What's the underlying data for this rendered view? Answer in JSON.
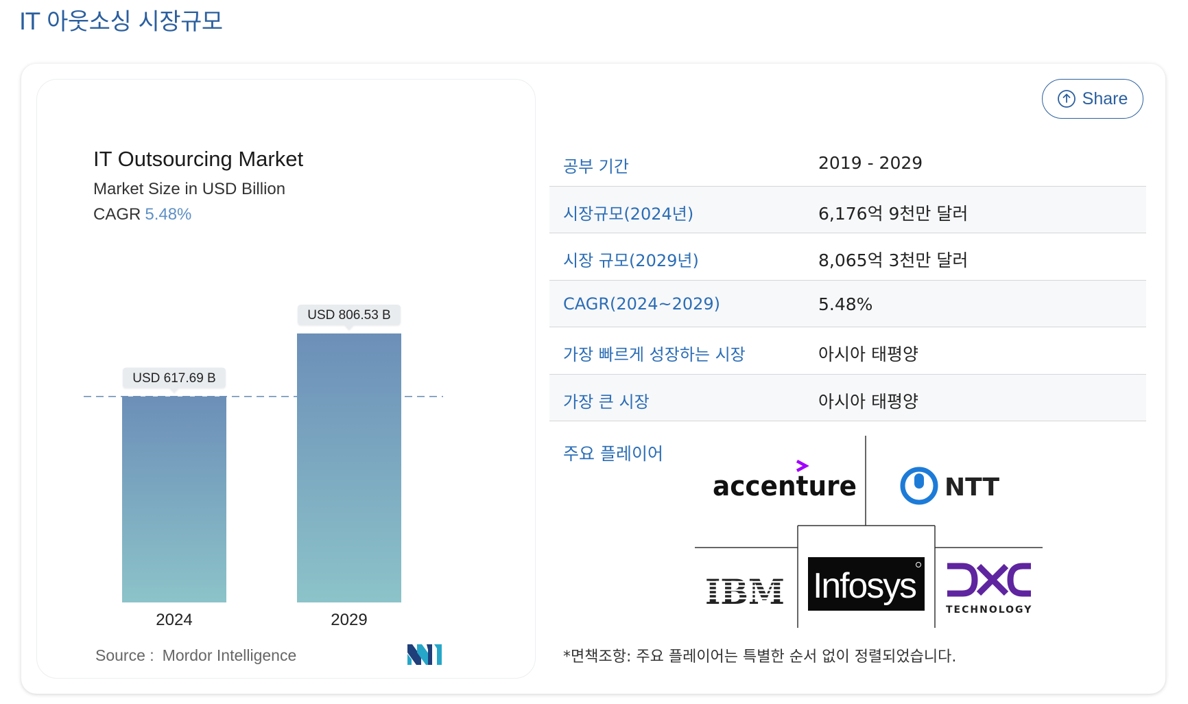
{
  "page": {
    "title": "IT 아웃소싱 시장규모"
  },
  "share": {
    "label": "Share"
  },
  "chart_card": {
    "source_label": "Source :",
    "source_value": "Mordor Intelligence"
  },
  "chart_data": {
    "type": "bar",
    "title": "IT Outsourcing Market",
    "subtitle": "Market Size in USD Billion",
    "cagr_label": "CAGR",
    "cagr_value": "5.48%",
    "categories": [
      "2024",
      "2029"
    ],
    "values": [
      617.69,
      806.53
    ],
    "data_labels": [
      "USD 617.69 B",
      "USD 806.53 B"
    ],
    "reference_line": 617.69,
    "bar_gradient": [
      "#6c8fb8",
      "#8cc3c9"
    ],
    "ylim": [
      0,
      806.53
    ],
    "grid": false
  },
  "facts": [
    {
      "label": "공부 기간",
      "value": "2019 - 2029"
    },
    {
      "label": "시장규모(2024년)",
      "value": "6,176억 9천만 달러"
    },
    {
      "label": "시장 규모(2029년)",
      "value": "8,065억 3천만 달러"
    },
    {
      "label": "CAGR(2024~2029)",
      "value": "5.48%"
    },
    {
      "label": "가장 빠르게 성장하는 시장",
      "value": "아시아 태평양"
    },
    {
      "label": "가장 큰 시장",
      "value": "아시아 태평양"
    }
  ],
  "players": {
    "label": "주요 플레이어",
    "logos": [
      {
        "name": "accenture",
        "icon": "accenture-logo"
      },
      {
        "name": "NTT",
        "icon": "ntt-logo"
      },
      {
        "name": "IBM",
        "icon": "ibm-logo"
      },
      {
        "name": "Infosys",
        "icon": "infosys-logo"
      },
      {
        "name": "DXC",
        "subtitle": "TECHNOLOGY",
        "icon": "dxc-logo"
      }
    ],
    "disclaimer": "*면책조항: 주요 플레이어는 특별한 순서 없이 정렬되었습니다."
  },
  "colors": {
    "accent": "#2b5f9e",
    "label_blue": "#2b6db5",
    "cagr_value": "#5e90c4",
    "accenture_purple": "#a100ff",
    "ntt_blue": "#1d7bd8"
  }
}
